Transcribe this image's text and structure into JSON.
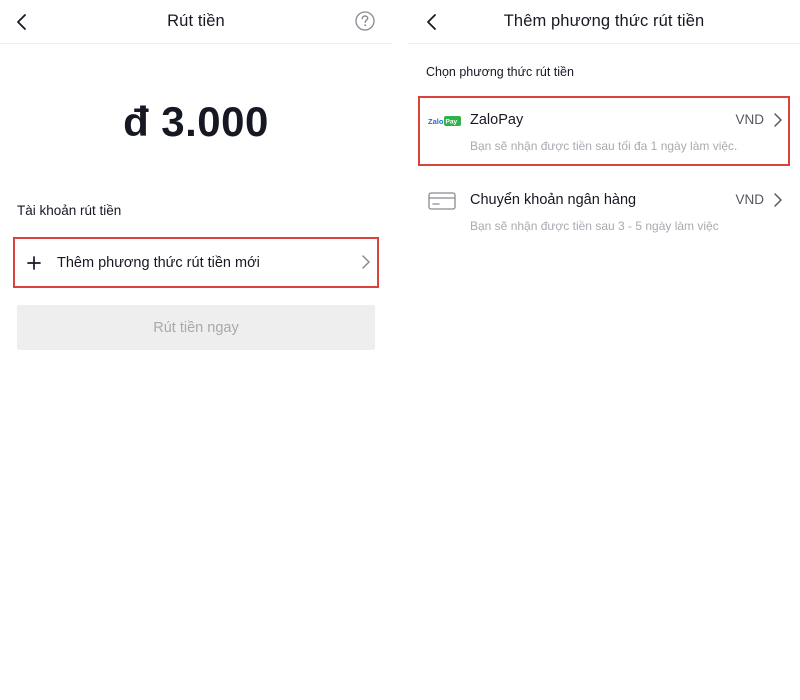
{
  "left": {
    "header": {
      "title": "Rút tiền",
      "back_icon": "chevron-left-icon",
      "help_icon": "question-circle-icon"
    },
    "amount": {
      "currency": "đ",
      "value": "3.000"
    },
    "account_section": {
      "label": "Tài khoản rút tiền"
    },
    "add_method": {
      "label": "Thêm phương thức rút tiền mới",
      "icon": "plus-icon"
    },
    "withdraw_button": {
      "label": "Rút tiền ngay"
    }
  },
  "right": {
    "header": {
      "title": "Thêm phương thức rút tiền",
      "back_icon": "chevron-left-icon"
    },
    "choose_label": "Chọn phương thức rút tiền",
    "methods": [
      {
        "name": "ZaloPay",
        "currency": "VND",
        "description": "Bạn sẽ nhận được tiền sau tối đa 1 ngày làm việc.",
        "icon": "zalopay-logo",
        "logo_text": "ZaloPay",
        "highlighted": true
      },
      {
        "name": "Chuyển khoản ngân hàng",
        "currency": "VND",
        "description": "Bạn sẽ nhận được tiền sau 3 - 5 ngày làm việc",
        "icon": "bank-card-icon",
        "highlighted": false
      }
    ]
  },
  "colors": {
    "highlight_border": "#d9433a",
    "text_primary": "#161823",
    "text_secondary": "#a9aab0",
    "button_disabled_bg": "#eeeeee",
    "zalopay_blue": "#1b6fd6",
    "zalopay_green": "#2db34a"
  }
}
